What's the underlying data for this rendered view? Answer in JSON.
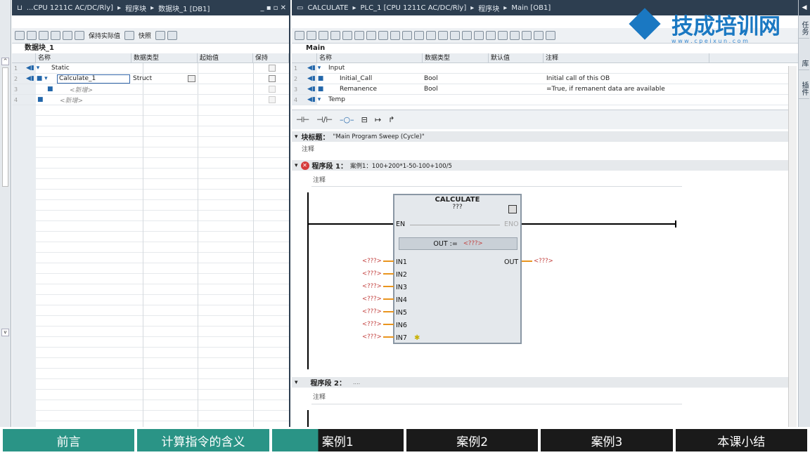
{
  "left_panel": {
    "breadcrumb": [
      "...CPU 1211C AC/DC/Rly]",
      "程序块",
      "数据块_1 [DB1]"
    ],
    "toolbar": {
      "keep_actual": "保持实际值",
      "snapshot": "快照"
    },
    "block_title": "数据块_1",
    "columns": [
      "名称",
      "数据类型",
      "起始值",
      "保持"
    ],
    "rows": [
      {
        "num": "1",
        "name": "Static",
        "type": "",
        "start": ""
      },
      {
        "num": "2",
        "name": "Calculate_1",
        "type": "Struct",
        "start": ""
      },
      {
        "num": "3",
        "name": "<新增>",
        "type": "",
        "start": ""
      },
      {
        "num": "4",
        "name": "<新增>",
        "type": "",
        "start": ""
      }
    ]
  },
  "right_panel": {
    "breadcrumb": [
      "CALCULATE",
      "PLC_1 [CPU 1211C AC/DC/Rly]",
      "程序块",
      "Main [OB1]"
    ],
    "block_title": "Main",
    "columns": [
      "名称",
      "数据类型",
      "默认值",
      "注释"
    ],
    "rows": [
      {
        "num": "1",
        "name": "Input",
        "type": "",
        "default": "",
        "comment": ""
      },
      {
        "num": "2",
        "name": "Initial_Call",
        "type": "Bool",
        "default": "",
        "comment": "Initial call of this OB"
      },
      {
        "num": "3",
        "name": "Remanence",
        "type": "Bool",
        "default": "",
        "comment": "=True, if remanent data are available"
      },
      {
        "num": "4",
        "name": "Temp",
        "type": "",
        "default": "",
        "comment": ""
      }
    ],
    "block_heading_label": "块标题：",
    "block_heading_value": "\"Main Program Sweep (Cycle)\"",
    "comment_label": "注释",
    "network1_label": "程序段 1：",
    "network1_title": "案例1：100+200*1-50-100+100/5",
    "network2_label": "程序段 2：",
    "network2_title": "....",
    "box": {
      "name": "CALCULATE",
      "type_placeholder": "???",
      "en": "EN",
      "eno": "ENO",
      "formula": "OUT :=",
      "formula_value": "<???>",
      "out": "OUT",
      "out_value": "<???>",
      "inputs": [
        "IN1",
        "IN2",
        "IN3",
        "IN4",
        "IN5",
        "IN6",
        "IN7"
      ],
      "input_value": "<???>"
    }
  },
  "logo": {
    "text": "技成培训网",
    "url_text": "w w w . c p e i x u n . c o m"
  },
  "side_tabs": [
    "任务",
    "库",
    "插件"
  ],
  "nav": [
    {
      "label": "前言",
      "color": "#2a9486"
    },
    {
      "label": "计算指令的含义",
      "color": "#2a9486"
    },
    {
      "label": "案例1",
      "color": "#2a9486"
    },
    {
      "label": "案例2",
      "color": "#1a1a1a"
    },
    {
      "label": "案例3",
      "color": "#1a1a1a"
    },
    {
      "label": "本课小结",
      "color": "#1a1a1a"
    }
  ]
}
